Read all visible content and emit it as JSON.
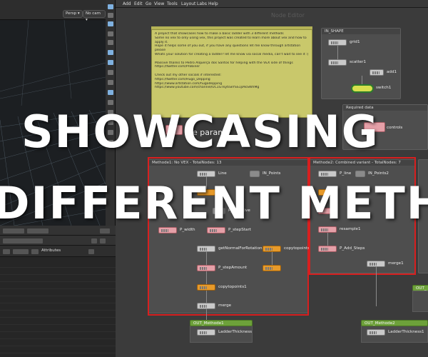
{
  "viewport": {
    "persp_label": "Persp ▾",
    "cam_label": "No cam ▾"
  },
  "parm_panel": {
    "attributes_label": "Attributes"
  },
  "menubar": [
    "Add",
    "Edit",
    "Go",
    "View",
    "Tools",
    "Layout",
    "Labs",
    "Help"
  ],
  "network": {
    "context_label": "Node Editor",
    "sticky_note": [
      "A project that showcases how to make a basic ladder with 3 different methods",
      "Some no vex to only using vex, this project was created to learn more about vex and how to",
      "apply it.",
      "Hope it helps some of you out, if you have any questions let me know through artstation",
      "please",
      "Whats your solution for creating a ladder? let me know via social media, can't wait to see it :)",
      "",
      "Massive thanks to Pedro Alquerça dos Santos for helping with the VEX side of things",
      "https://twitter.com/Probiner",
      "",
      "Check out my other socials if interested:",
      "https://twitter.com/Hugo_Depping",
      "https://www.artstation.com/hugodepping",
      "https://www.youtube.com/channel/UC1GTkytswYSS1jIAkSWhMg"
    ],
    "in_shape": {
      "title": "IN_SHAPE",
      "nodes": [
        "grid1",
        "scatter1",
        "add1",
        "switch1"
      ]
    },
    "required": {
      "title": "Required data",
      "controls_label": "controls"
    },
    "example_params_label": "ple param",
    "methode1": {
      "title": "Methode1: No VEX - TotalNodes: 13",
      "nodes": {
        "line": "Line",
        "in_points": "IN_Points",
        "p_primitive": "P_Primitive",
        "p_width": "P_width",
        "p_stepstart": "P_stepStart",
        "getnormal": "getNormalForRotation",
        "copytopoints_a": "copytopoints",
        "p_stepamount": "P_stepAmount",
        "copytopoints1": "copytopoints1",
        "merge": "merge"
      }
    },
    "methode2": {
      "title": "Methode2: Combined variant - TotalNodes: 7",
      "nodes": {
        "p_line": "P_line",
        "in_points2": "IN_Points2",
        "resample1": "resample1",
        "p_add_steps": "P_Add_Steps",
        "merge1": "merge1"
      }
    },
    "out1": {
      "title": "OUT_Methode1",
      "node": "LadderThickness"
    },
    "out2": {
      "title": "OUT_Methode2",
      "node": "LadderThickness1"
    },
    "out3": {
      "title": "OUT_"
    }
  },
  "overlay": {
    "line1": "SHOWCASING",
    "line2": "DIFFERENT METHODS"
  }
}
